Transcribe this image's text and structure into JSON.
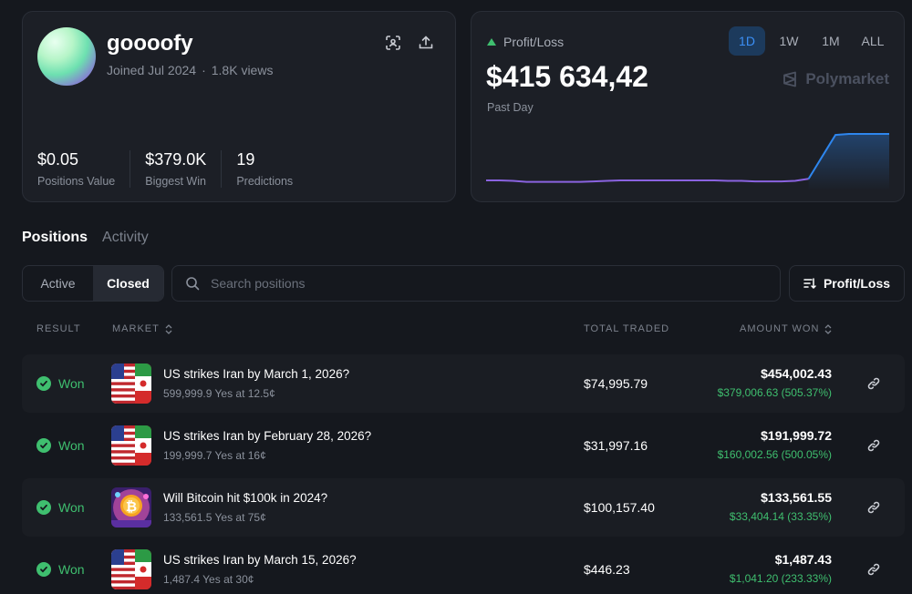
{
  "profile": {
    "username": "goooofy",
    "joined": "Joined Jul 2024",
    "separator": "·",
    "views": "1.8K views",
    "stats": [
      {
        "value": "$0.05",
        "label": "Positions Value"
      },
      {
        "value": "$379.0K",
        "label": "Biggest Win"
      },
      {
        "value": "19",
        "label": "Predictions"
      }
    ]
  },
  "pnl": {
    "label": "Profit/Loss",
    "value": "$415 634,42",
    "period": "Past Day",
    "ranges": [
      "1D",
      "1W",
      "1M",
      "ALL"
    ],
    "active_range": "1D",
    "brand": "Polymarket",
    "colors": {
      "line_before": "#8a63e0",
      "line_after": "#2e86ee",
      "up": "#3fbf6f"
    },
    "chart_data": {
      "type": "line",
      "x": [
        0,
        1,
        2,
        3,
        4,
        5,
        6,
        7,
        8,
        9,
        10,
        11,
        12,
        13,
        14,
        15,
        16,
        17,
        18,
        19,
        20,
        21,
        22,
        23,
        24,
        25,
        26,
        27,
        28,
        29,
        30
      ],
      "y": [
        0.09,
        0.09,
        0.08,
        0.06,
        0.06,
        0.06,
        0.06,
        0.06,
        0.07,
        0.08,
        0.09,
        0.09,
        0.09,
        0.09,
        0.09,
        0.09,
        0.09,
        0.09,
        0.08,
        0.08,
        0.07,
        0.07,
        0.07,
        0.08,
        0.12,
        0.55,
        0.98,
        1.0,
        1.0,
        1.0,
        1.0
      ],
      "jump_index": 24
    }
  },
  "tabs": [
    "Positions",
    "Activity"
  ],
  "filters": {
    "status": [
      "Active",
      "Closed"
    ],
    "active_status": "Closed",
    "search_placeholder": "Search positions",
    "sort_label": "Profit/Loss"
  },
  "table": {
    "headers": {
      "result": "RESULT",
      "market": "MARKET",
      "traded": "TOTAL TRADED",
      "won": "AMOUNT WON"
    },
    "rows": [
      {
        "result": "Won",
        "icon": "us-iran-flags",
        "title": "US strikes Iran by March 1, 2026?",
        "sub": "599,999.9 Yes at 12.5¢",
        "traded": "$74,995.79",
        "won": "$454,002.43",
        "profit": "$379,006.63 (505.37%)"
      },
      {
        "result": "Won",
        "icon": "us-iran-flags",
        "title": "US strikes Iran by February 28, 2026?",
        "sub": "199,999.7 Yes at 16¢",
        "traded": "$31,997.16",
        "won": "$191,999.72",
        "profit": "$160,002.56 (500.05%)"
      },
      {
        "result": "Won",
        "icon": "bitcoin-art",
        "title": "Will Bitcoin hit $100k in 2024?",
        "sub": "133,561.5 Yes at 75¢",
        "traded": "$100,157.40",
        "won": "$133,561.55",
        "profit": "$33,404.14 (33.35%)"
      },
      {
        "result": "Won",
        "icon": "us-iran-flags",
        "title": "US strikes Iran by March 15, 2026?",
        "sub": "1,487.4 Yes at 30¢",
        "traded": "$446.23",
        "won": "$1,487.43",
        "profit": "$1,041.20 (233.33%)"
      }
    ]
  }
}
